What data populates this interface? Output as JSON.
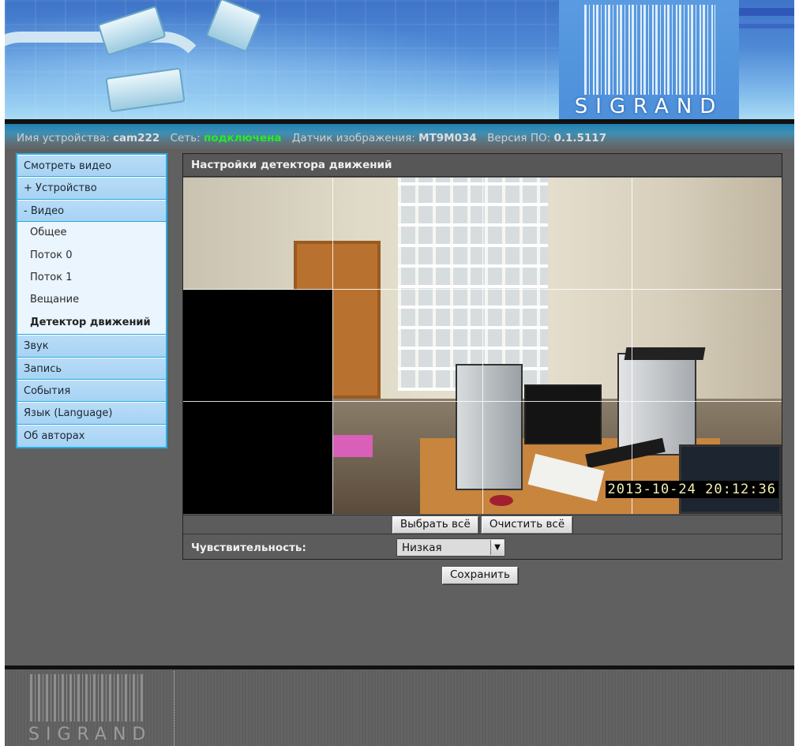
{
  "brand": {
    "logo_text": "SIGRAND"
  },
  "status_bar": {
    "device_name_label": "Имя устройства:",
    "device_name_value": "cam222",
    "network_label": "Сеть:",
    "network_value": "подключена",
    "sensor_label": "Датчик изображения:",
    "sensor_value": "MT9M034",
    "firmware_label": "Версия ПО:",
    "firmware_value": "0.1.5117",
    "network_status_color": "#22ee22"
  },
  "sidebar": {
    "items": [
      {
        "label": "Смотреть видео"
      },
      {
        "label": "+ Устройство"
      },
      {
        "label": "- Видео"
      }
    ],
    "video_subitems": [
      {
        "label": "Общее"
      },
      {
        "label": "Поток 0"
      },
      {
        "label": "Поток 1"
      },
      {
        "label": "Вещание"
      },
      {
        "label": "Детектор движений",
        "active": true
      }
    ],
    "items_after": [
      {
        "label": "Звук"
      },
      {
        "label": "Запись"
      },
      {
        "label": "События"
      },
      {
        "label": "Язык (Language)"
      },
      {
        "label": "Об авторах"
      }
    ]
  },
  "panel": {
    "title": "Настройки детектора движений",
    "video": {
      "timestamp": "2013-10-24 20:12:36",
      "grid_columns": 4,
      "grid_rows": 3,
      "masked_cells": [
        4,
        8
      ]
    },
    "select_all_label": "Выбрать всё",
    "clear_all_label": "Очистить всё",
    "sensitivity_label": "Чувствительность:",
    "sensitivity_value": "Низкая"
  },
  "save_label": "Сохранить",
  "colors": {
    "sidebar_border": "#24b0e8",
    "panel_bg": "#606060",
    "banner_blue": "#4f8ad6"
  }
}
